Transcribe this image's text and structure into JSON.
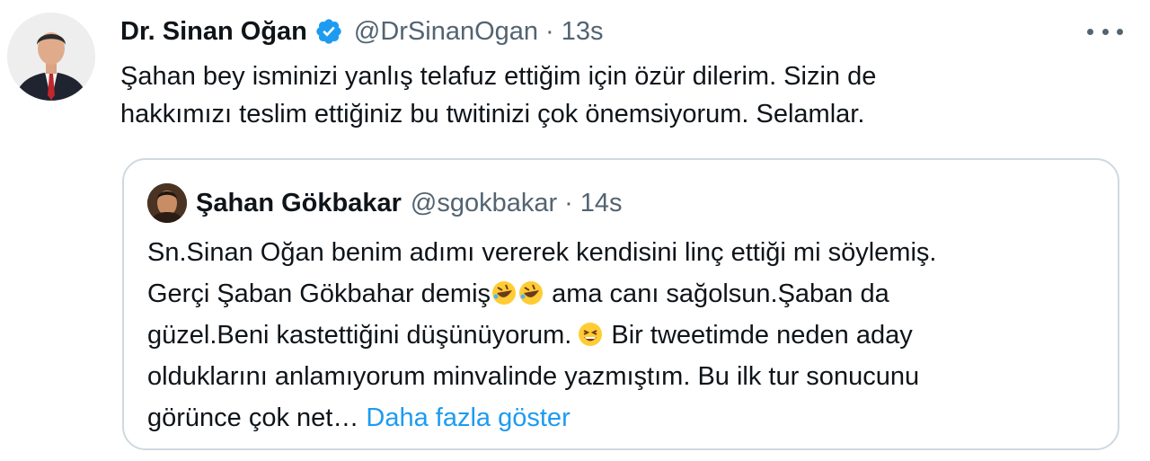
{
  "tweet": {
    "author_name": "Dr. Sinan Oğan",
    "handle": "@DrSinanOgan",
    "separator": "·",
    "time": "13s",
    "text_line1": "Şahan bey isminizi yanlış telafuz ettiğim için özür dilerim. Sizin de",
    "text_line2": "hakkımızı teslim ettiğiniz bu twitinizi çok önemsiyorum. Selamlar."
  },
  "quote": {
    "author_name": "Şahan Gökbakar",
    "handle": "@sgokbakar",
    "separator": "·",
    "time": "14s",
    "line1": "Sn.Sinan Oğan benim adımı vererek kendisini linç ettiği mi söylemiş.",
    "line2_a": "Gerçi  Şaban Gökbahar demiş",
    "line2_b": " ama canı sağolsun.Şaban da",
    "line3_a": "güzel.Beni kastettiğini düşünüyorum.",
    "line3_b": " Bir tweetimde neden aday",
    "line4": "olduklarını anlamıyorum minvalinde yazmıştım. Bu ilk tur sonucunu",
    "line5": "görünce çok net… ",
    "show_more": "Daha fazla göster"
  },
  "icons": {
    "verified": "verified-badge-icon",
    "more": "more-options-icon",
    "emoji_laugh": "rolling-on-floor-laughing-emoji",
    "emoji_grin": "grinning-squinting-emoji"
  },
  "colors": {
    "accent": "#1d9bf0",
    "secondary_text": "#536471",
    "border": "#cfd9de"
  }
}
